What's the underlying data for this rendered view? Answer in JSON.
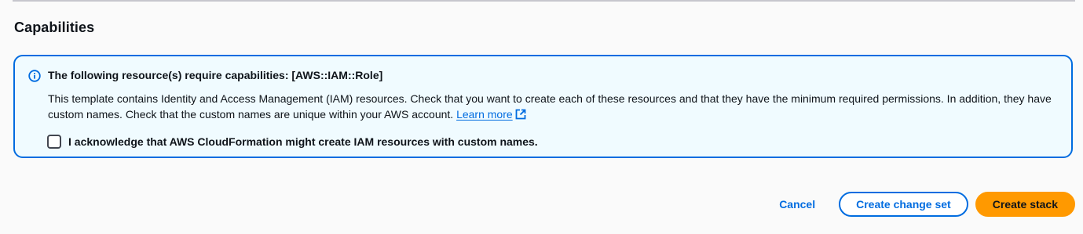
{
  "section": {
    "title": "Capabilities"
  },
  "alert": {
    "icon": "info-icon",
    "header": "The following resource(s) require capabilities: [AWS::IAM::Role]",
    "body_text": "This template contains Identity and Access Management (IAM) resources. Check that you want to create each of these resources and that they have the minimum required permissions. In addition, they have custom names. Check that the custom names are unique within your AWS account.",
    "learn_more_label": "Learn more",
    "learn_more_icon": "external-link-icon",
    "acknowledge_label": "I acknowledge that AWS CloudFormation might create IAM resources with custom names.",
    "acknowledge_checked": false
  },
  "footer": {
    "cancel_label": "Cancel",
    "change_set_label": "Create change set",
    "create_stack_label": "Create stack"
  },
  "colors": {
    "accent": "#006ce0",
    "alert_background": "#f0fbff",
    "primary_button": "#ff9900",
    "page_background": "#fafafa"
  }
}
